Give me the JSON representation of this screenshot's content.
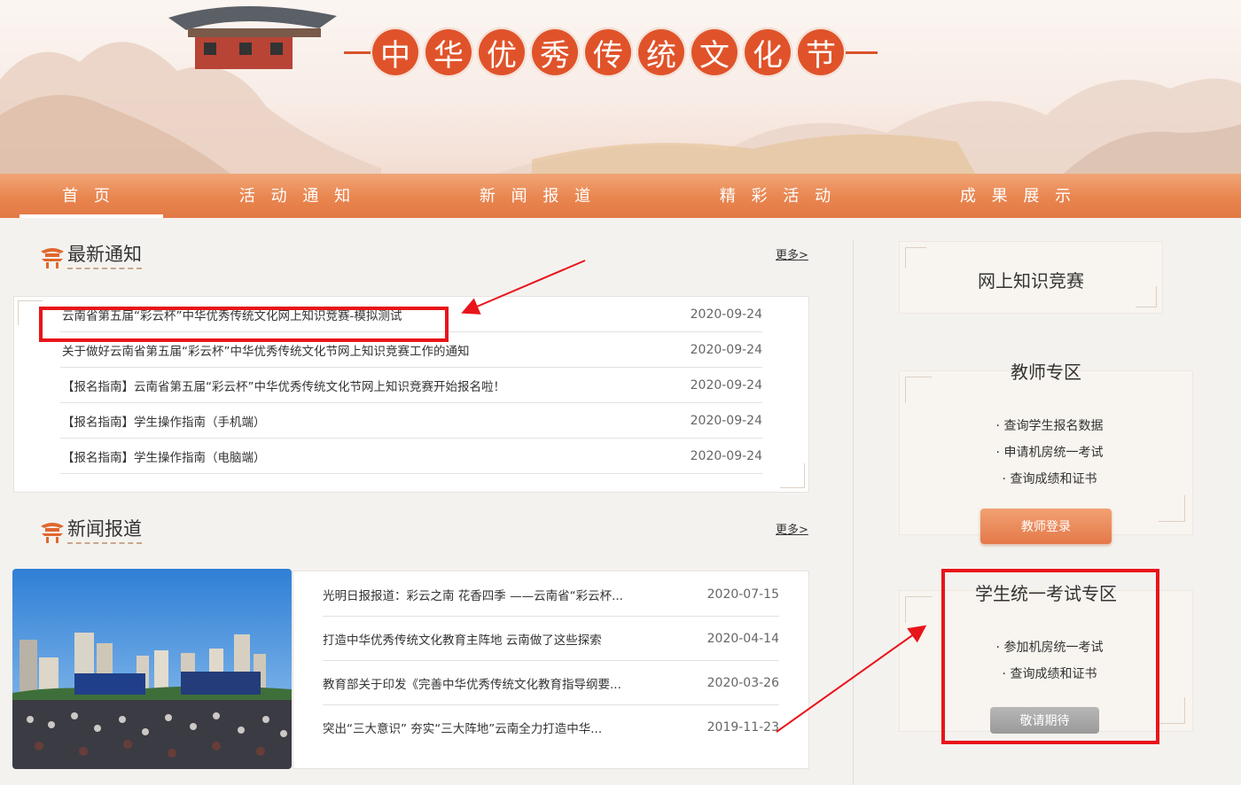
{
  "banner": {
    "title_chars": [
      "中",
      "华",
      "优",
      "秀",
      "传",
      "统",
      "文",
      "化",
      "节"
    ]
  },
  "nav": {
    "items": [
      "首 页",
      "活 动 通 知",
      "新 闻 报 道",
      "精 彩 活 动",
      "成 果 展 示"
    ]
  },
  "notices": {
    "title": "最新通知",
    "more": "更多>",
    "items": [
      {
        "title": "云南省第五届“彩云杯”中华优秀传统文化网上知识竞赛-模拟测试",
        "date": "2020-09-24"
      },
      {
        "title": "关于做好云南省第五届“彩云杯”中华优秀传统文化节网上知识竞赛工作的通知",
        "date": "2020-09-24"
      },
      {
        "title": "【报名指南】云南省第五届“彩云杯”中华优秀传统文化节网上知识竞赛开始报名啦！",
        "date": "2020-09-24"
      },
      {
        "title": "【报名指南】学生操作指南（手机端）",
        "date": "2020-09-24"
      },
      {
        "title": "【报名指南】学生操作指南（电脑端）",
        "date": "2020-09-24"
      }
    ]
  },
  "news": {
    "title": "新闻报道",
    "more": "更多>",
    "items": [
      {
        "title": "光明日报报道：彩云之南 花香四季 ——云南省“彩云杯...",
        "date": "2020-07-15"
      },
      {
        "title": "打造中华优秀传统文化教育主阵地 云南做了这些探索",
        "date": "2020-04-14"
      },
      {
        "title": "教育部关于印发《完善中华优秀传统文化教育指导纲要...",
        "date": "2020-03-26"
      },
      {
        "title": "突出“三大意识” 夯实“三大阵地”云南全力打造中华...",
        "date": "2019-11-23"
      }
    ]
  },
  "sidebar": {
    "contest": {
      "title": "网上知识竞赛"
    },
    "teacher": {
      "title": "教师专区",
      "links": [
        "· 查询学生报名数据",
        "· 申请机房统一考试",
        "· 查询成绩和证书"
      ],
      "button": "教师登录"
    },
    "student": {
      "title": "学生统一考试专区",
      "links": [
        "· 参加机房统一考试",
        "· 查询成绩和证书"
      ],
      "button": "敬请期待"
    }
  },
  "colors": {
    "accent": "#e0532a",
    "nav": "#e9854f",
    "highlight": "#e8141a"
  }
}
